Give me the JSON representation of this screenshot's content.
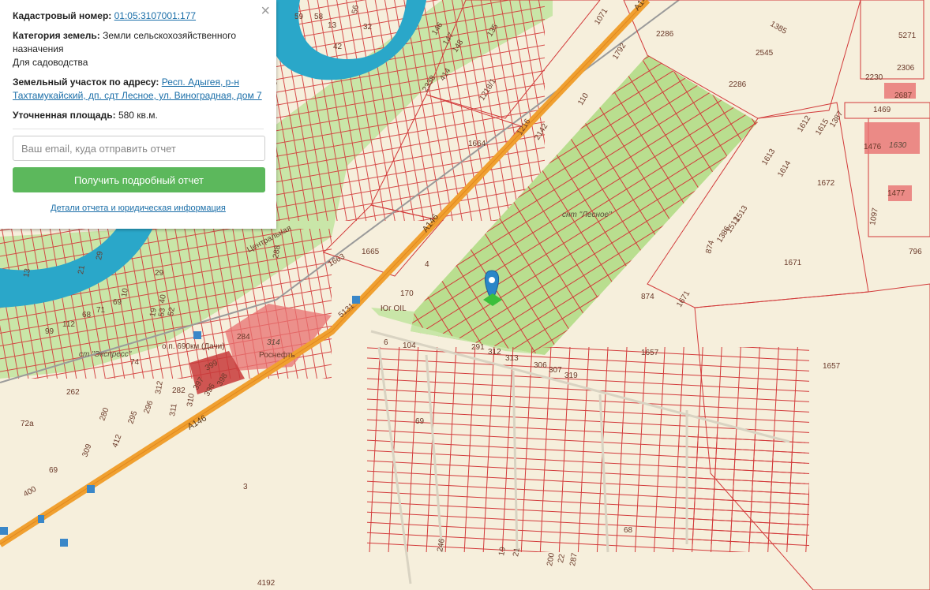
{
  "info_card": {
    "cadastral_label": "Кадастровый номер:",
    "cadastral_value": "01:05:3107001:177",
    "category_label": "Категория земель:",
    "category_value": "Земли сельскохозяйственного назначения",
    "usage": "Для садоводства",
    "address_label": "Земельный участок по адресу:",
    "address_value": "Респ. Адыгея, р-н Тахтамукайский, дп. сдт Лесное, ул. Виноградная, дом 7",
    "area_label": "Уточненная площадь:",
    "area_value": "580 кв.м.",
    "email_placeholder": "Ваш email, куда отправить отчет",
    "report_button": "Получить подробный отчет",
    "details_link": "Детали отчета и юридическая информация",
    "close_symbol": "×"
  },
  "map": {
    "colors": {
      "background": "#f6efdc",
      "parcel_border": "#d23a3a",
      "green_area": "#b9de8f",
      "river": "#2aa7c9",
      "road": "#f0a030",
      "highlight": "#e87070",
      "marker": "#2a86c8"
    },
    "marker_icon": "map-pin-icon",
    "labels": {
      "road_a146_1": "А146",
      "road_a146_2": "А146",
      "road_a146_3": "А146",
      "street_central": "Центральная",
      "snt_lesnoe": "снт \"Лесное\"",
      "snt_ekspress": "ст \"Экспресс\"",
      "stop": "о.п. 690км (Дачи)",
      "rosneft": "Роснефть",
      "yug_oil": "Юг OIL",
      "road_1216": "1216",
      "road_1218": "1218/1",
      "n5131": "5131",
      "n2286a": "2286",
      "n2286b": "2286",
      "n2545": "2545",
      "n1385": "1385",
      "n1664": "1664",
      "n2142": "2142",
      "n1665": "1665",
      "n1663": "1663",
      "n1672": "1672",
      "n1671a": "1671",
      "n1671b": "1671",
      "n1657a": "1657",
      "n1657b": "1657",
      "n874a": "874",
      "n874b": "874",
      "n796": "796",
      "n2230": "2230",
      "n2306": "2306",
      "n2687": "2687",
      "n1469": "1469",
      "n1476": "1476",
      "n1630": "1630",
      "n1477": "1477",
      "n1612": "1612",
      "n1613": "1613",
      "n1614": "1614",
      "n1615": "1615",
      "n1387": "1387",
      "n1513": "1513",
      "n1512": "1512",
      "n1386": "1386",
      "n1792": "1792",
      "n110": "110",
      "n1071": "1071",
      "n5271": "5271",
      "n1097": "1097",
      "n170": "170",
      "n104": "104",
      "n291": "291",
      "n312": "312",
      "n313": "313",
      "n306": "306",
      "n307": "307",
      "n319": "319",
      "n69a": "69",
      "n69b": "69",
      "n68": "68",
      "n246": "246",
      "n19": "19",
      "n21": "21",
      "n200": "200",
      "n22": "22",
      "n287": "287",
      "n4192": "4192",
      "n284": "284",
      "n314": "314",
      "n399": "399",
      "n398": "398",
      "n397": "397",
      "n396": "396",
      "n282": "282",
      "n312b": "312",
      "n311": "311",
      "n310": "310",
      "n296": "296",
      "n295": "295",
      "n280": "280",
      "n412": "412",
      "n309": "309",
      "n262": "262",
      "n400": "400",
      "n3": "3",
      "n6": "6",
      "n4": "4",
      "n288": "288",
      "n74": "74",
      "n99": "99",
      "n112": "112",
      "n68b": "68",
      "n71": "71",
      "n69c": "69",
      "n29": "29",
      "n13": "13",
      "n21b": "21",
      "n40": "40",
      "n19b": "19",
      "n53": "53",
      "n52": "52",
      "n29b": "29",
      "n59": "59",
      "n58": "58",
      "n13b": "13",
      "n42": "42",
      "n32": "32",
      "n56": "56",
      "n146": "146",
      "n147": "147",
      "n148": "148",
      "n135": "135",
      "n414": "414",
      "n2338": "2338",
      "n26": "26",
      "n72a": "72а",
      "n10": "10"
    }
  }
}
